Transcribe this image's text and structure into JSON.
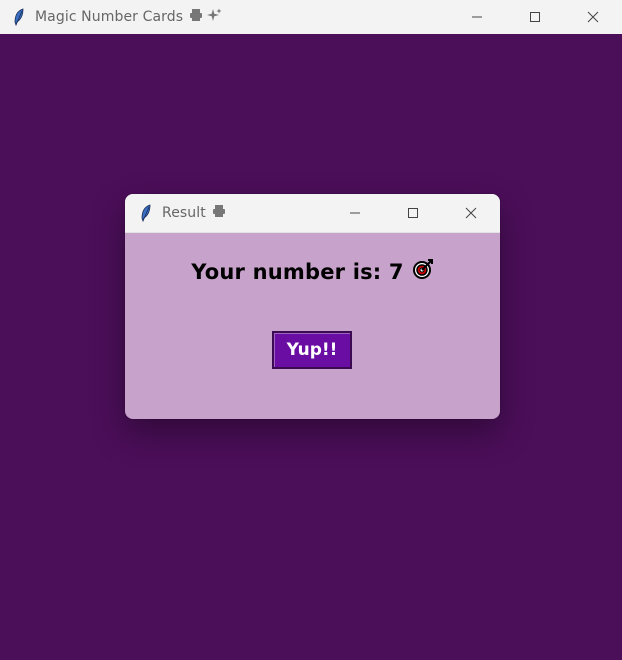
{
  "main_window": {
    "title": "Magic Number Cards",
    "title_emoji": [
      "printer-icon",
      "sparkles-icon"
    ],
    "background_color": "#4b0e59"
  },
  "dialog": {
    "title": "Result",
    "message": "Your number is: 7",
    "message_icon": "target-icon",
    "button_label": "Yup!!",
    "button_color": "#6a0ea3",
    "background_color": "#c7a2ca"
  },
  "window_controls": {
    "minimize": "minimize-icon",
    "maximize": "maximize-icon",
    "close": "close-icon"
  }
}
